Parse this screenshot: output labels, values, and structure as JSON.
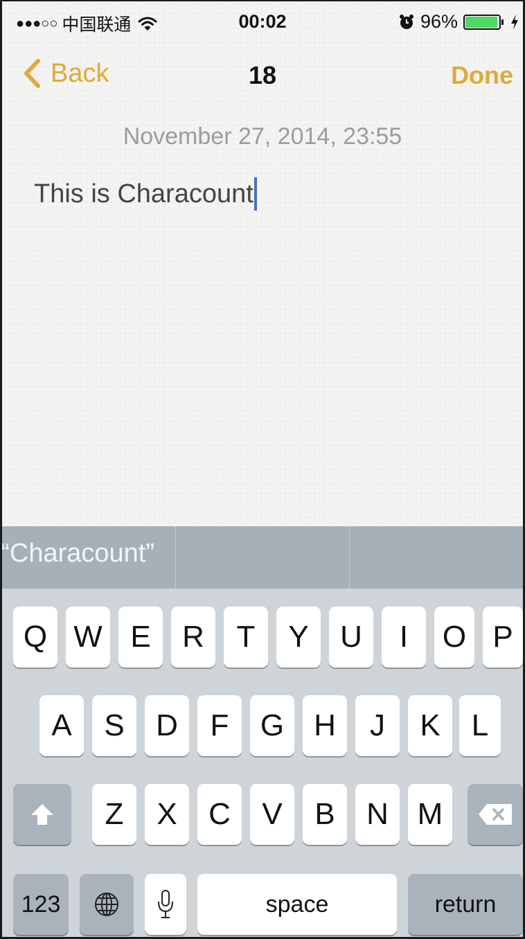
{
  "status_bar": {
    "signal": "●●●○○",
    "carrier": "中国联通",
    "time": "00:02",
    "battery_percent": "96%",
    "battery_level": 0.96,
    "icons": [
      "wifi-icon",
      "alarm-icon",
      "battery-icon",
      "charging-bolt-icon"
    ]
  },
  "nav": {
    "back_label": "Back",
    "title": "18",
    "done_label": "Done",
    "accent_color": "#dfaa3a"
  },
  "note": {
    "date": "November 27, 2014, 23:55",
    "body": "This is Characount"
  },
  "prediction": {
    "items": [
      "“Characount”",
      "",
      ""
    ]
  },
  "keyboard": {
    "row1": [
      "Q",
      "W",
      "E",
      "R",
      "T",
      "Y",
      "U",
      "I",
      "O",
      "P"
    ],
    "row2": [
      "A",
      "S",
      "D",
      "F",
      "G",
      "H",
      "J",
      "K",
      "L"
    ],
    "row3": [
      "Z",
      "X",
      "C",
      "V",
      "B",
      "N",
      "M"
    ],
    "numbers_label": "123",
    "space_label": "space",
    "return_label": "return",
    "icons": [
      "shift-icon",
      "delete-icon",
      "globe-icon",
      "microphone-icon"
    ]
  }
}
